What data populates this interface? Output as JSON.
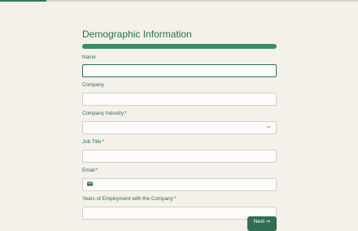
{
  "progress": {
    "fraction": 0.13
  },
  "form": {
    "title": "Demographic Information",
    "fields": [
      {
        "label": "Name",
        "required": false,
        "value": ""
      },
      {
        "label": "Company",
        "required": false,
        "value": ""
      },
      {
        "label": "Company Industry",
        "required": true,
        "value": ""
      },
      {
        "label": "Job Title",
        "required": true,
        "value": ""
      },
      {
        "label": "Email",
        "required": true,
        "value": ""
      },
      {
        "label": "Years of Employment with the Company",
        "required": true,
        "value": ""
      }
    ],
    "required_marker": "*",
    "next_label": "Next ⇒"
  },
  "colors": {
    "accent": "#2f7d5b",
    "title": "#26704f",
    "required": "#a93434",
    "background": "#f4f0ea"
  },
  "icons": {
    "dropdown": "chevron-down-icon",
    "email": "envelope-icon"
  }
}
